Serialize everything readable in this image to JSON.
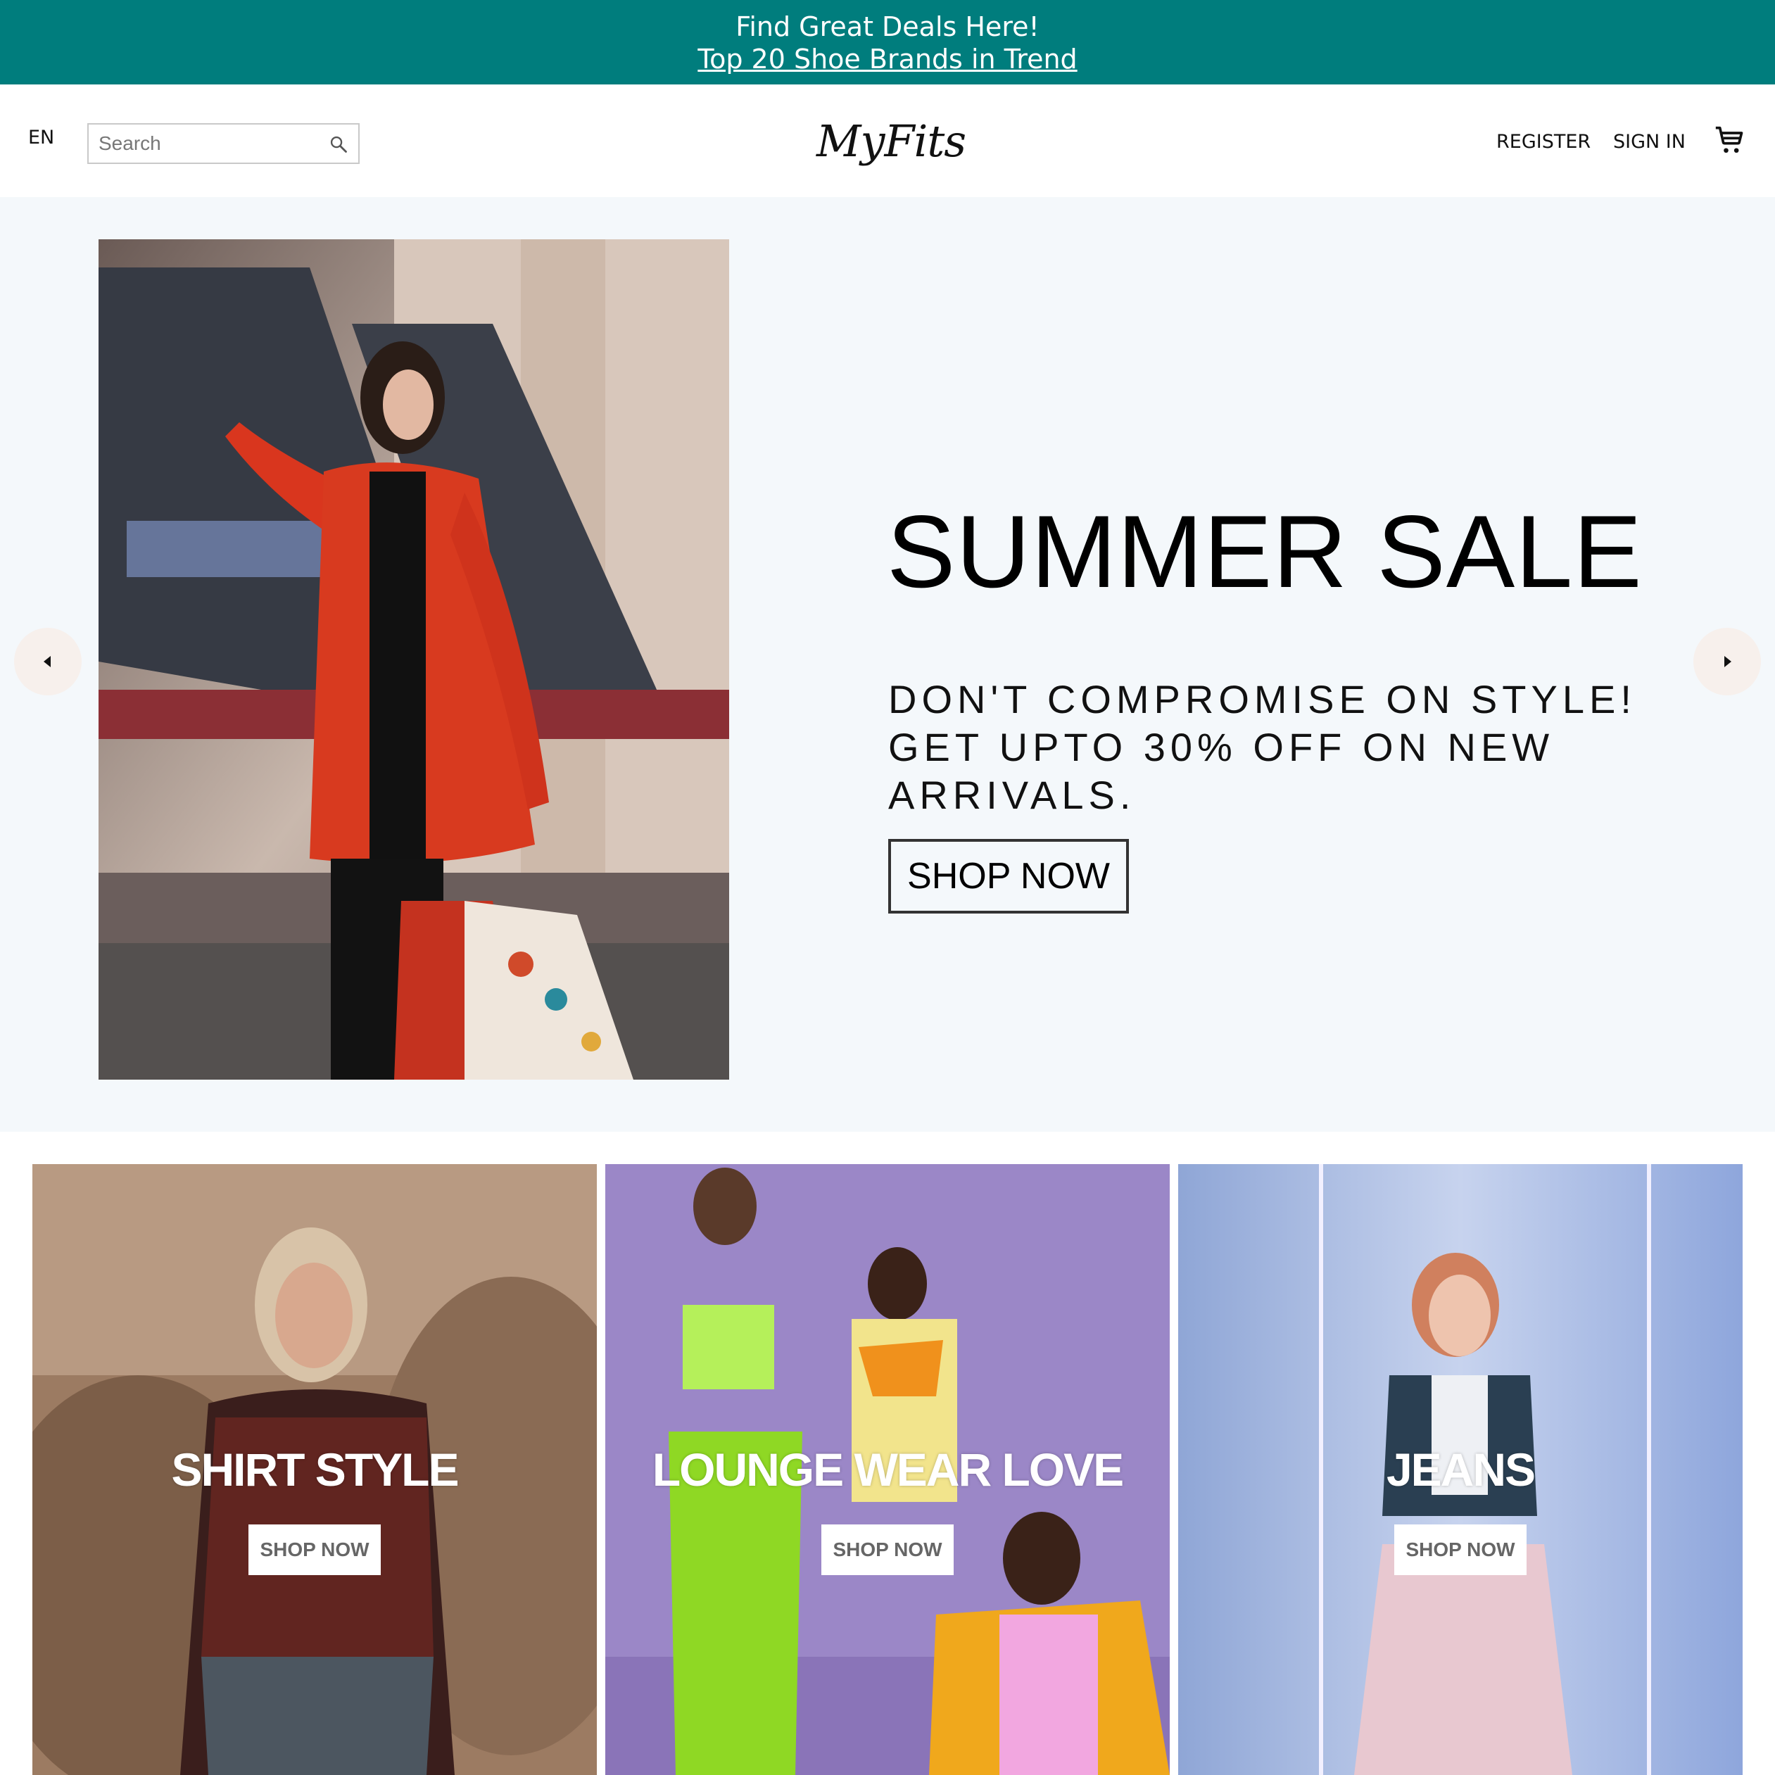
{
  "announcement": {
    "line1": "Find Great Deals Here!",
    "line2": "Top 20 Shoe Brands in Trend"
  },
  "header": {
    "language": "EN",
    "search_placeholder": "Search",
    "logo": "MyFits",
    "register": "REGISTER",
    "sign_in": "SIGN IN"
  },
  "hero": {
    "title": "SUMMER SALE",
    "subtitle": "DON'T COMPROMISE ON STYLE! GET UPTO 30% OFF ON NEW ARRIVALS.",
    "button": "SHOP NOW"
  },
  "categories": [
    {
      "title": "SHIRT STYLE",
      "button": "SHOP NOW"
    },
    {
      "title": "LOUNGE WEAR LOVE",
      "button": "SHOP NOW"
    },
    {
      "title": "JEANS",
      "button": "SHOP NOW"
    }
  ],
  "colors": {
    "announcement_bg": "#007d7d",
    "hero_bg": "#f4f8fb"
  },
  "icons": [
    "search-icon",
    "cart-icon",
    "chevron-left-icon",
    "chevron-right-icon"
  ]
}
